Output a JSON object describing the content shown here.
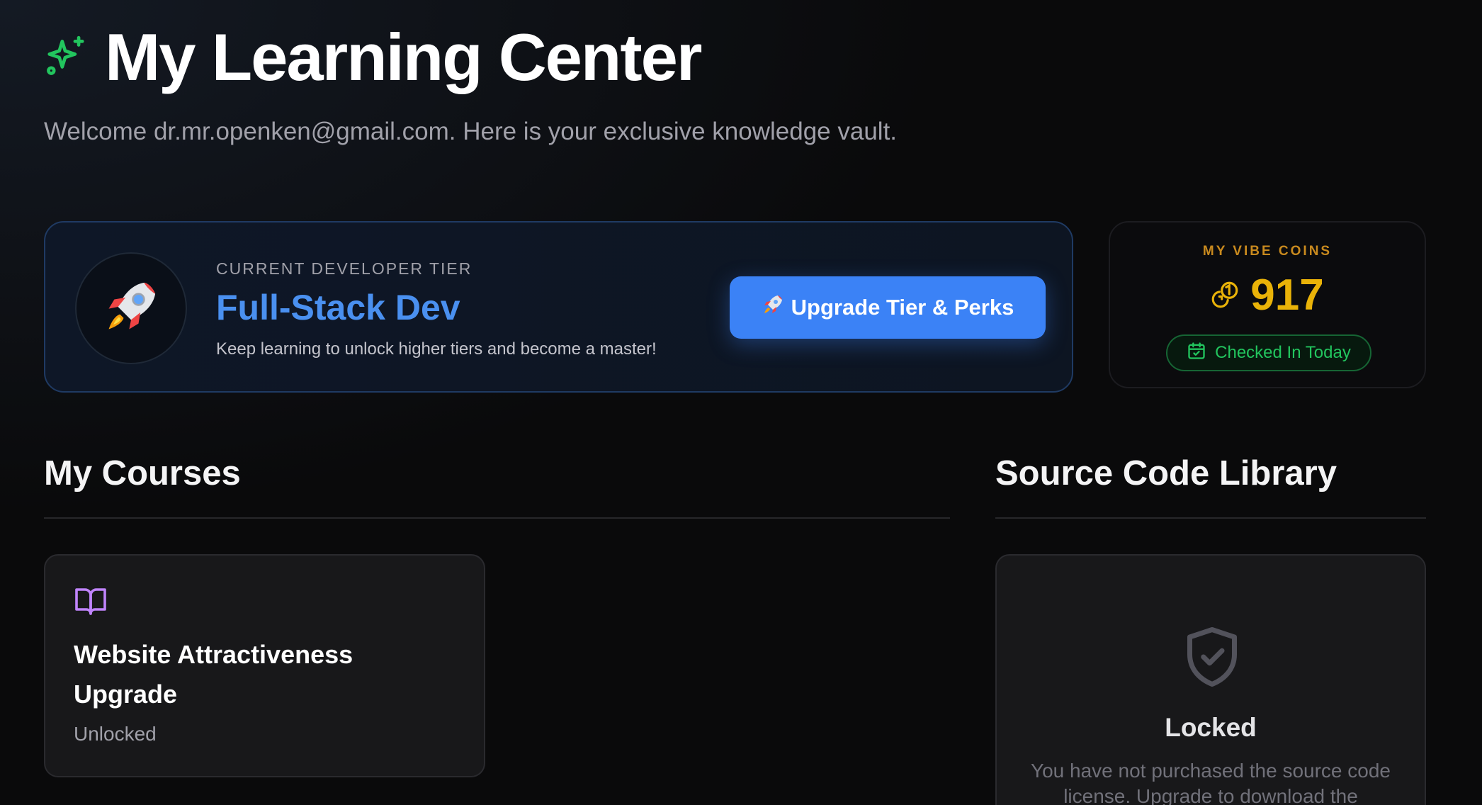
{
  "header": {
    "title": "My Learning Center",
    "icon": "sparkles-icon",
    "subtitle": "Welcome dr.mr.openken@gmail.com. Here is your exclusive knowledge vault."
  },
  "tier": {
    "label": "CURRENT DEVELOPER TIER",
    "name": "Full-Stack Dev",
    "description": "Keep learning to unlock higher tiers and become a master!",
    "avatar_icon": "rocket-icon",
    "upgrade_button": "Upgrade Tier & Perks"
  },
  "coins": {
    "label": "MY VIBE COINS",
    "value": "917",
    "checkin_label": "Checked In Today"
  },
  "courses": {
    "section_title": "My Courses",
    "items": [
      {
        "title": "Website Attractiveness Upgrade",
        "status": "Unlocked",
        "icon": "book-open-icon"
      }
    ]
  },
  "source_code": {
    "section_title": "Source Code Library",
    "locked_title": "Locked",
    "locked_description": "You have not purchased the source code license. Upgrade to download the",
    "icon": "shield-check-icon"
  },
  "colors": {
    "background": "#0a0a0b",
    "accent_blue": "#3b82f6",
    "tier_name": "#4a90f0",
    "coins_gold": "#eab308",
    "checkin_green": "#22c55e",
    "sparkle_green": "#22c55e",
    "book_purple": "#c084fc"
  }
}
